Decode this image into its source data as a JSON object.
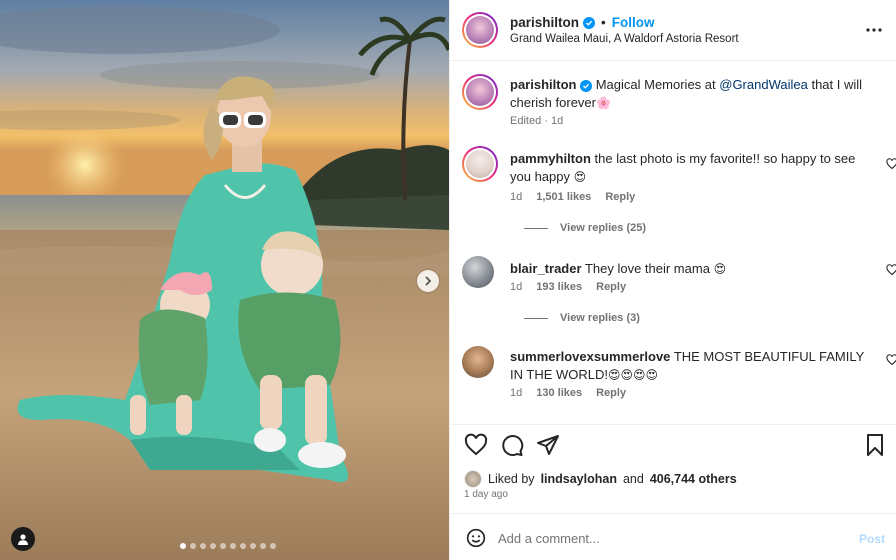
{
  "post": {
    "author": "parishilton",
    "follow_label": "Follow",
    "bullet": "•",
    "location": "Grand Wailea Maui, A Waldorf Astoria Resort",
    "more_icon": "more-horizontal-icon",
    "carousel": {
      "total_slides": 10,
      "active_index": 0
    }
  },
  "caption": {
    "author": "parishilton",
    "text_before": "Magical Memories at ",
    "mention": "@GrandWailea",
    "text_after": " that I will cherish forever",
    "emoji": "🌸",
    "edited": "Edited",
    "sep": "·",
    "time": "1d"
  },
  "comments": [
    {
      "author": "pammyhilton",
      "text": "the last photo is my favorite!! so happy to see you happy",
      "emoji": "😍",
      "time": "1d",
      "likes": "1,501 likes",
      "reply": "Reply",
      "view_replies": "View replies (25)"
    },
    {
      "author": "blair_trader",
      "text": "They love their mama",
      "emoji": "😍",
      "time": "1d",
      "likes": "193 likes",
      "reply": "Reply",
      "view_replies": "View replies (3)"
    },
    {
      "author": "summerlovexsummerlove",
      "text": "THE MOST BEAUTIFUL FAMILY IN THE WORLD!",
      "emoji": "😍😍😍😍",
      "time": "1d",
      "likes": "130 likes",
      "reply": "Reply"
    }
  ],
  "actions": {
    "icons": [
      "heart-icon",
      "comment-icon",
      "share-icon",
      "bookmark-icon"
    ],
    "liked_prefix": "Liked by",
    "liked_user": "lindsaylohan",
    "liked_suffix": "and",
    "liked_count": "406,744 others",
    "time_ago": "1 day ago"
  },
  "composer": {
    "placeholder": "Add a comment...",
    "post_label": "Post"
  },
  "colors": {
    "accent": "#0095f6",
    "mention": "#00376b",
    "muted": "#737373",
    "post_disabled": "#b3dbff",
    "dress": "#4fc4aa"
  }
}
